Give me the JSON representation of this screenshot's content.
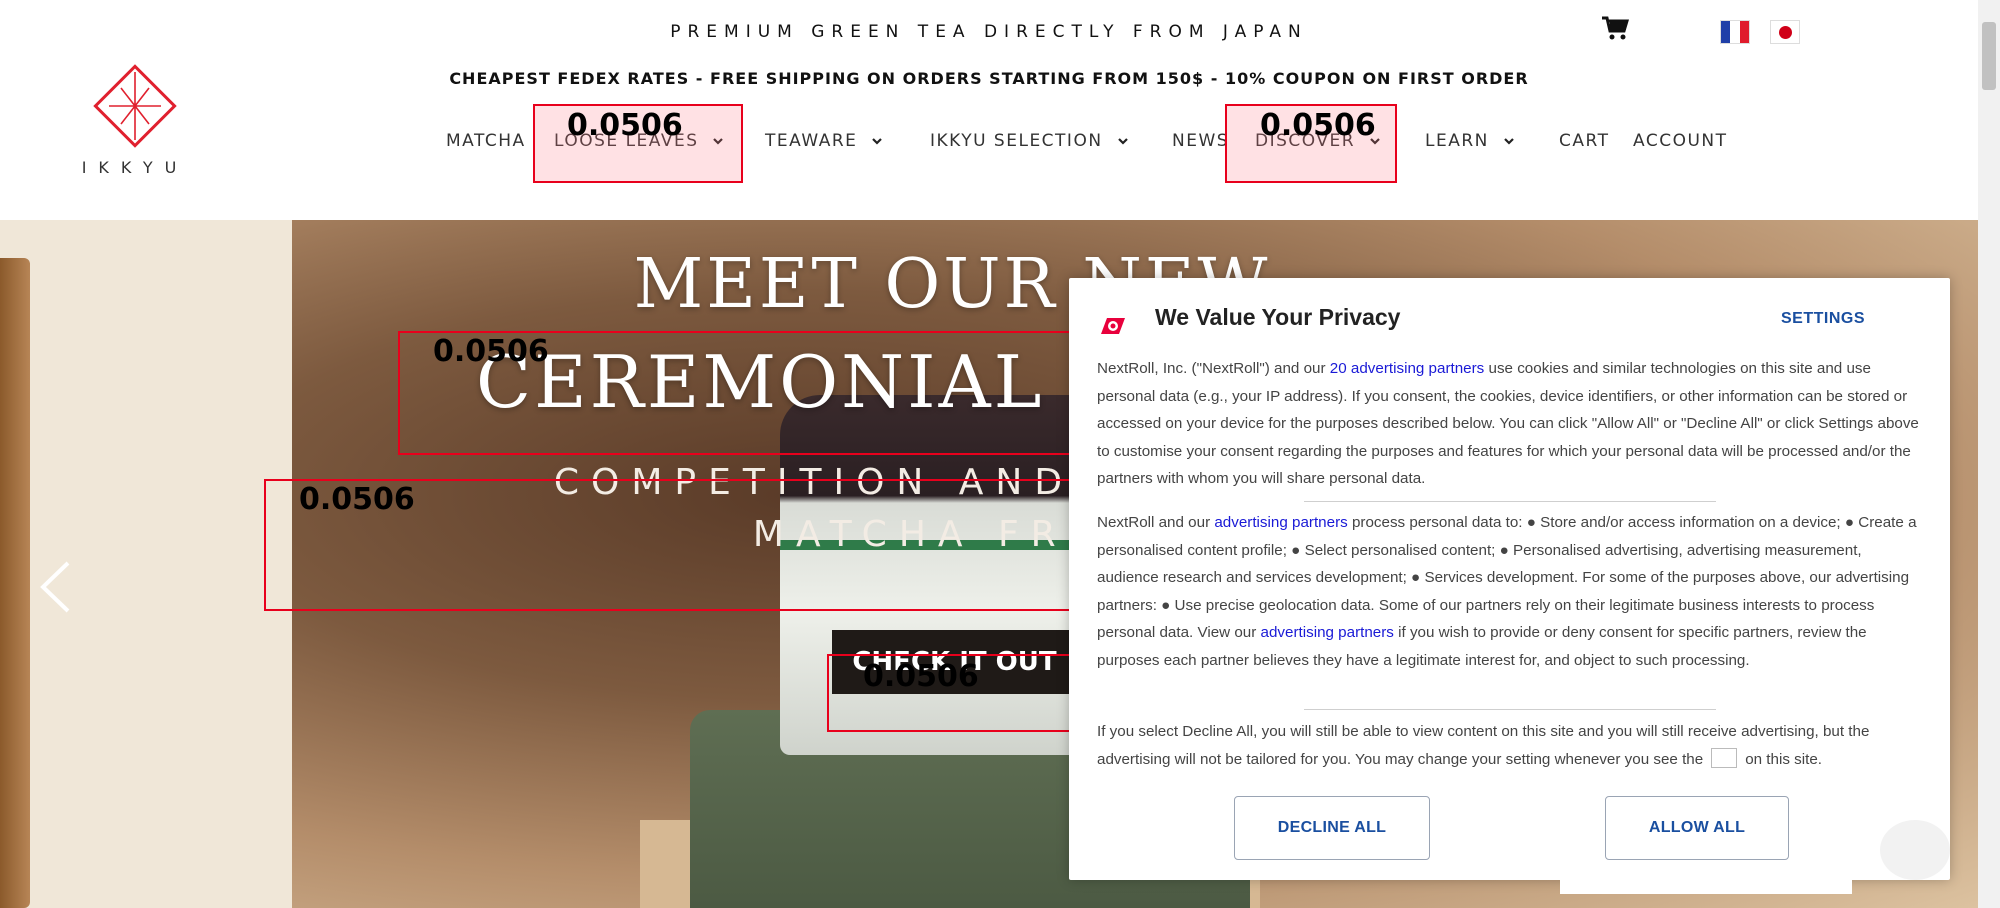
{
  "header": {
    "tagline": "PREMIUM GREEN TEA DIRECTLY FROM JAPAN",
    "shipping_banner": "CHEAPEST FEDEX RATES - FREE SHIPPING ON ORDERS STARTING FROM 150$ - 10% COUPON ON FIRST ORDER",
    "logo_text": "IKKYU",
    "cart_icon": "cart-icon",
    "flags": [
      "flag-fr-icon",
      "flag-jp-icon"
    ]
  },
  "nav": {
    "items": [
      {
        "label": "MATCHA"
      },
      {
        "label": "LOOSE LEAVES"
      },
      {
        "label": "TEAWARE"
      },
      {
        "label": "IKKYU SELECTION"
      },
      {
        "label": "NEWS"
      },
      {
        "label": "DISCOVER"
      },
      {
        "label": "LEARN"
      },
      {
        "label": "CART"
      },
      {
        "label": "ACCOUNT"
      }
    ]
  },
  "hero": {
    "title_line1": "MEET OUR NEW",
    "title_line2": "CEREMONIAL MATCHA",
    "subtitle_line1": "COMPETITION AND PREMIUM",
    "subtitle_line2": "MATCHA FROM",
    "cta_label": "CHECK IT OUT"
  },
  "annotations": {
    "box1": "0.0506",
    "box2": "0.0506",
    "box3": "0.0506",
    "box4": "0.0506",
    "box5": "0.0506"
  },
  "privacy": {
    "title": "We Value Your Privacy",
    "settings_label": "SETTINGS",
    "p1_a": "NextRoll, Inc. (\"NextRoll\") and our ",
    "p1_link": "20 advertising partners",
    "p1_b": " use cookies and similar technologies on this site and use personal data (e.g., your IP address). If you consent, the cookies, device identifiers, or other information can be stored or accessed on your device for the purposes described below. You can click \"Allow All\" or \"Decline All\" or click Settings above to customise your consent regarding the purposes and features for which your personal data will be processed and/or the partners with whom you will share personal data.",
    "p2_a": "NextRoll and our ",
    "p2_link1": "advertising partners",
    "p2_b": " process personal data to: ● Store and/or access information on a device; ● Create a personalised content profile; ● Select personalised content; ● Personalised advertising, advertising measurement, audience research and services development; ● Services development. For some of the purposes above, our advertising partners: ● Use precise geolocation data. Some of our partners rely on their legitimate business interests to process personal data. View our ",
    "p2_link2": "advertising partners",
    "p2_c": " if you wish to provide or deny consent for specific partners, review the purposes each partner believes they have a legitimate interest for, and object to such processing.",
    "p3_a": "If you select Decline All, you will still be able to view content on this site and you will still receive advertising, but the advertising will not be tailored for you. You may change your setting whenever you see the",
    "p3_b": "on this site.",
    "decline_label": "DECLINE ALL",
    "allow_label": "ALLOW ALL"
  },
  "colors": {
    "accent_red": "#e8001c",
    "link_blue": "#1a1ad6",
    "button_blue": "#1a4fa0"
  }
}
